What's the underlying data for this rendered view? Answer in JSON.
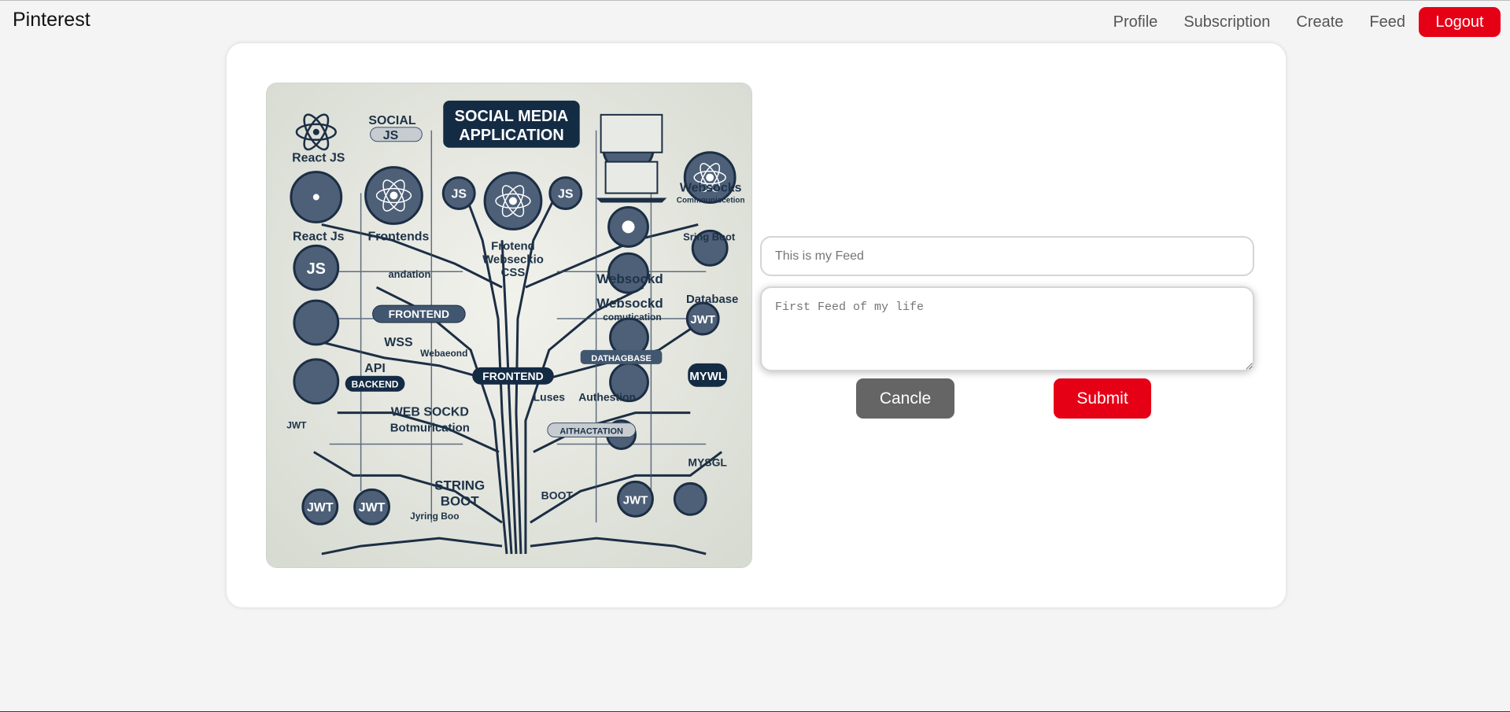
{
  "navbar": {
    "brand": "Pinterest",
    "links": [
      "Profile",
      "Subscription",
      "Create",
      "Feed"
    ],
    "logout_label": "Logout"
  },
  "form": {
    "title_placeholder": "This is my Feed",
    "description_placeholder": "First Feed of my life",
    "cancel_label": "Cancle",
    "submit_label": "Submit"
  },
  "image": {
    "labels": {
      "main_title_1": "SOCIAL MEDIA",
      "main_title_2": "APPLICATION",
      "social": "SOCIAL",
      "js_top": "JS",
      "react_1": "React JS",
      "react_2": "React Js",
      "frontends": "Frontends",
      "js_left": "JS",
      "andation": "andation",
      "frontend_tag_1": "FRONTEND",
      "wss": "WSS",
      "api": "API",
      "backend": "BACKEND",
      "web_sockd": "WEB SOCKD",
      "botmurication": "Botmurication",
      "jwt_small": "JWT",
      "jwt_1": "JWT",
      "jwt_2": "JWT",
      "string_boot_1": "STRING",
      "string_boot_2": "BOOT",
      "jyring_boo": "Jyring Boo",
      "js_mid_1": "JS",
      "js_mid_2": "JS",
      "frontend_mid": "Frotend",
      "websecklo": "Webseckio",
      "css": "CSS",
      "webaeond": "Webaeond",
      "frontend_tag_2": "FRONTEND",
      "websocks": "Websocks",
      "communication": "Commnuniscetion",
      "sring_boot": "Sring Boot",
      "websockd_1": "Websockd",
      "websockd_2": "Websockd",
      "comutication": "comutication",
      "database": "Database",
      "jwt_right": "JWT",
      "dathagbase": "DATHAGBASE",
      "mywl": "MYWL",
      "luses": "Luses",
      "authestion": "Authestion",
      "aithactation": "AITHACTATION",
      "mysgl": "MYSGL",
      "boot": "BOOT",
      "jwt_bottom": "JWT"
    }
  }
}
